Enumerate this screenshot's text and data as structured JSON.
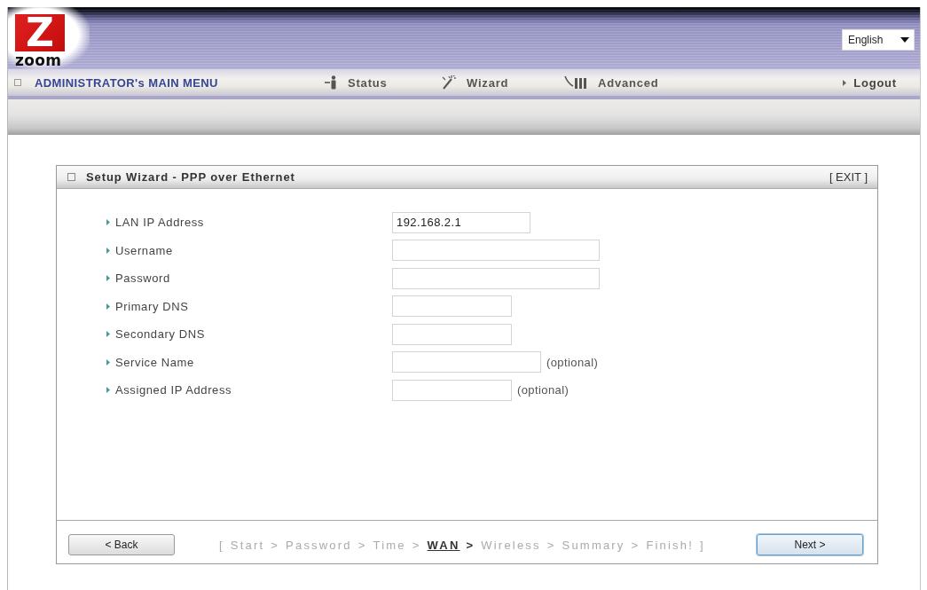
{
  "header": {
    "logo": {
      "mark": "Z",
      "wordmark": "zoom"
    },
    "language": {
      "value": "English"
    }
  },
  "menu": {
    "title": "ADMINISTRATOR's MAIN MENU",
    "items": [
      {
        "kind": "status",
        "label": "Status"
      },
      {
        "kind": "wizard",
        "label": "Wizard"
      },
      {
        "kind": "advanced",
        "label": "Advanced"
      }
    ],
    "logout": "Logout"
  },
  "panel": {
    "title": "Setup Wizard - PPP over Ethernet",
    "exit": "[ EXIT ]",
    "fields": [
      {
        "label": "LAN IP Address",
        "value": "192.168.2.1"
      },
      {
        "label": "Username"
      },
      {
        "label": "Password"
      },
      {
        "label": "Primary DNS"
      },
      {
        "label": "Secondary DNS"
      },
      {
        "label": "Service Name",
        "note": "(optional)"
      },
      {
        "label": "Assigned IP Address",
        "note": "(optional)"
      }
    ],
    "footer": {
      "back": {
        "label": "< Back",
        "focused": false
      },
      "steps": {
        "open": "[",
        "close": "]",
        "items": [
          {
            "label": "Start",
            "selected": false,
            "separator": ">"
          },
          {
            "label": "Password",
            "selected": false,
            "separator": ">"
          },
          {
            "label": "Time",
            "selected": false,
            "separator": ">"
          },
          {
            "label": "WAN",
            "selected": true,
            "separator": ">"
          },
          {
            "label": "Wireless",
            "selected": false,
            "separator": ">"
          },
          {
            "label": "Summary",
            "selected": false,
            "separator": ">"
          },
          {
            "label": "Finish!",
            "selected": false
          }
        ]
      },
      "next": {
        "label": "Next >",
        "focused": true
      }
    }
  }
}
